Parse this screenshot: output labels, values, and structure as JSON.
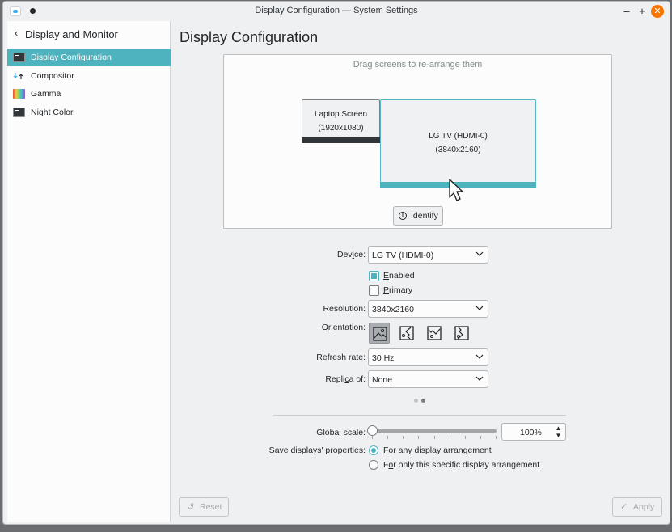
{
  "window": {
    "title": "Display Configuration — System Settings"
  },
  "titlebar": {
    "minimize": "–",
    "maximize": "+",
    "close": "✕"
  },
  "sidebar": {
    "back_label": "Display and Monitor",
    "items": [
      {
        "label": "Display Configuration",
        "icon": "monitor-icon",
        "active": true
      },
      {
        "label": "Compositor",
        "icon": "compositor-icon",
        "active": false
      },
      {
        "label": "Gamma",
        "icon": "gamma-icon",
        "active": false
      },
      {
        "label": "Night Color",
        "icon": "night-color-icon",
        "active": false
      }
    ]
  },
  "main": {
    "title": "Display Configuration",
    "arrange": {
      "hint": "Drag screens to re-arrange them",
      "screens": [
        {
          "name": "Laptop Screen",
          "resolution": "(1920x1080)"
        },
        {
          "name": "LG TV (HDMI-0)",
          "resolution": "(3840x2160)"
        }
      ],
      "identify_label": "Identify"
    },
    "form": {
      "device_label_pre": "Dev",
      "device_label_u": "i",
      "device_label_post": "ce:",
      "device_value": "LG TV (HDMI-0)",
      "enabled_label_pre": "",
      "enabled_label_u": "E",
      "enabled_label_post": "nabled",
      "enabled": true,
      "primary_label_pre": "",
      "primary_label_u": "P",
      "primary_label_post": "rimary",
      "primary": false,
      "resolution_label_pre": "Resolution",
      "resolution_label_u": "",
      "resolution_label_post": ":",
      "resolution_value": "3840x2160",
      "orientation_label_pre": "O",
      "orientation_label_u": "r",
      "orientation_label_post": "ientation:",
      "refresh_label_pre": "Refres",
      "refresh_label_u": "h",
      "refresh_label_post": " rate:",
      "refresh_value": "30 Hz",
      "replica_label_pre": "Repli",
      "replica_label_u": "c",
      "replica_label_post": "a of:",
      "replica_value": "None",
      "page_dots": [
        false,
        true
      ]
    },
    "global": {
      "scale_label": "Global scale:",
      "scale_value": "100%",
      "scale_fraction": 0.0,
      "save_label_pre": "",
      "save_label_u": "S",
      "save_label_post": "ave displays' properties:",
      "option_any_pre": "",
      "option_any_u": "F",
      "option_any_post": "or any display arrangement",
      "option_specific_pre": "F",
      "option_specific_u": "o",
      "option_specific_post": "r only this specific display arrangement",
      "selected_option": "any"
    },
    "footer": {
      "reset_label": "Reset",
      "apply_label": "Apply"
    }
  },
  "colors": {
    "accent": "#4fb3bf",
    "close": "#f67400"
  }
}
